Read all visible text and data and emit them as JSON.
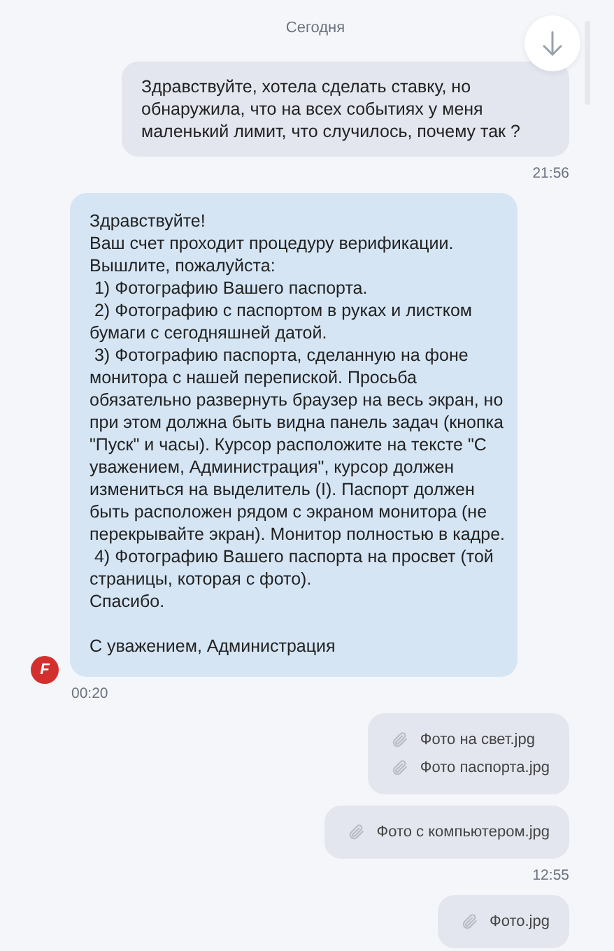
{
  "date_divider": "Сегодня",
  "messages": [
    {
      "kind": "text",
      "outgoing": true,
      "text": "Здравствуйте, хотела сделать ставку, но обнаружила, что на всех событиях у меня маленький лимит, что случилось, почему так ?",
      "time": "21:56"
    },
    {
      "kind": "text",
      "outgoing": false,
      "avatar": "F",
      "text": "Здравствуйте!\nВаш счет проходит процедуру верификации.\nВышлите, пожалуйста:\n 1) Фотографию Вашего паспорта.\n 2) Фотографию с паспортом в руках и листком бумаги с сегодняшней датой.\n 3) Фотографию паспорта, сделанную на фоне монитора с нашей перепиской. Просьба обязательно развернуть браузер на весь экран, но при этом должна быть видна панель задач (кнопка \"Пуск\" и часы). Курсор расположите на тексте \"С уважением, Администрация\", курсор должен измениться на выделитель (I). Паспорт должен быть расположен рядом с экраном монитора (не перекрывайте экран). Монитор полностью в кадре.\n 4) Фотографию Вашего паспорта на просвет (той страницы, которая с фото).\nСпасибо.\n\nС уважением, Администрация",
      "time": "00:20"
    },
    {
      "kind": "files",
      "outgoing": true,
      "files": [
        "Фото на свет.jpg",
        "Фото паспорта.jpg"
      ]
    },
    {
      "kind": "files",
      "outgoing": true,
      "files": [
        "Фото с компьютером.jpg"
      ],
      "time": "12:55"
    },
    {
      "kind": "files",
      "outgoing": true,
      "files": [
        "Фото.jpg"
      ]
    }
  ]
}
